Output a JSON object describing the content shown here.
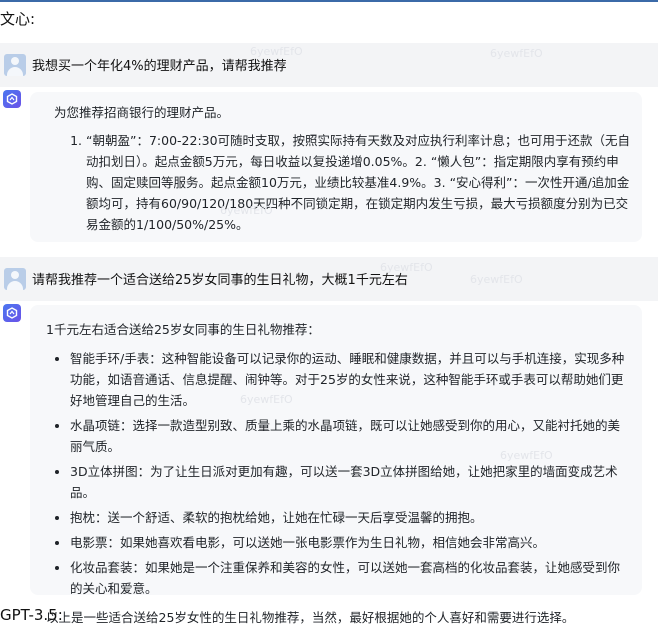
{
  "labels": {
    "top": "文心:",
    "bottom": "GPT-3.5:"
  },
  "watermark": "6yewfEfO",
  "q1": {
    "text": "我想买一个年化4%的理财产品，请帮我推荐"
  },
  "a1": {
    "intro": "为您推荐招商银行的理财产品。",
    "item1": "“朝朝盈”：7:00-22:30可随时支取，按照实际持有天数及对应执行利率计息；也可用于还款（无自动扣划日）。起点金额5万元，每日收益以复投递增0.05%。2. “懒人包”：指定期限内享有预约申购、固定赎回等服务。起点金额10万元，业绩比较基准4.9%。3. “安心得利”：一次性开通/追加金额均可，持有60/90/120/180天四种不同锁定期，在锁定期内发生亏损，最大亏损额度分别为已交易金额的1/100/50%/25%。"
  },
  "q2": {
    "text": "请帮我推荐一个适合送给25岁女同事的生日礼物，大概1千元左右"
  },
  "a2": {
    "intro": "1千元左右适合送给25岁女同事的生日礼物推荐：",
    "items": [
      "智能手环/手表：这种智能设备可以记录你的运动、睡眠和健康数据，并且可以与手机连接，实现多种功能，如语音通话、信息提醒、闹钟等。对于25岁的女性来说，这种智能手环或手表可以帮助她们更好地管理自己的生活。",
      "水晶项链：选择一款造型别致、质量上乘的水晶项链，既可以让她感受到你的用心，又能衬托她的美丽气质。",
      "3D立体拼图：为了让生日派对更加有趣，可以送一套3D立体拼图给她，让她把家里的墙面变成艺术品。",
      "抱枕：送一个舒适、柔软的抱枕给她，让她在忙碌一天后享受温馨的拥抱。",
      "电影票：如果她喜欢看电影，可以送她一张电影票作为生日礼物，相信她会非常高兴。",
      "化妆品套装：如果她是一个注重保养和美容的女性，可以送她一套高档的化妆品套装，让她感受到你的关心和爱意。"
    ],
    "outro": "以上是一些适合送给25岁女性的生日礼物推荐，当然，最好根据她的个人喜好和需要进行选择。"
  },
  "icons": {
    "user": "user-avatar-icon",
    "bot": "bot-logo-icon"
  },
  "colors": {
    "user_bar": "#f3f4f6",
    "answer_bg": "#f7f8fa",
    "bot_icon": "#5b66ef",
    "top_line": "#3b6aa8"
  }
}
